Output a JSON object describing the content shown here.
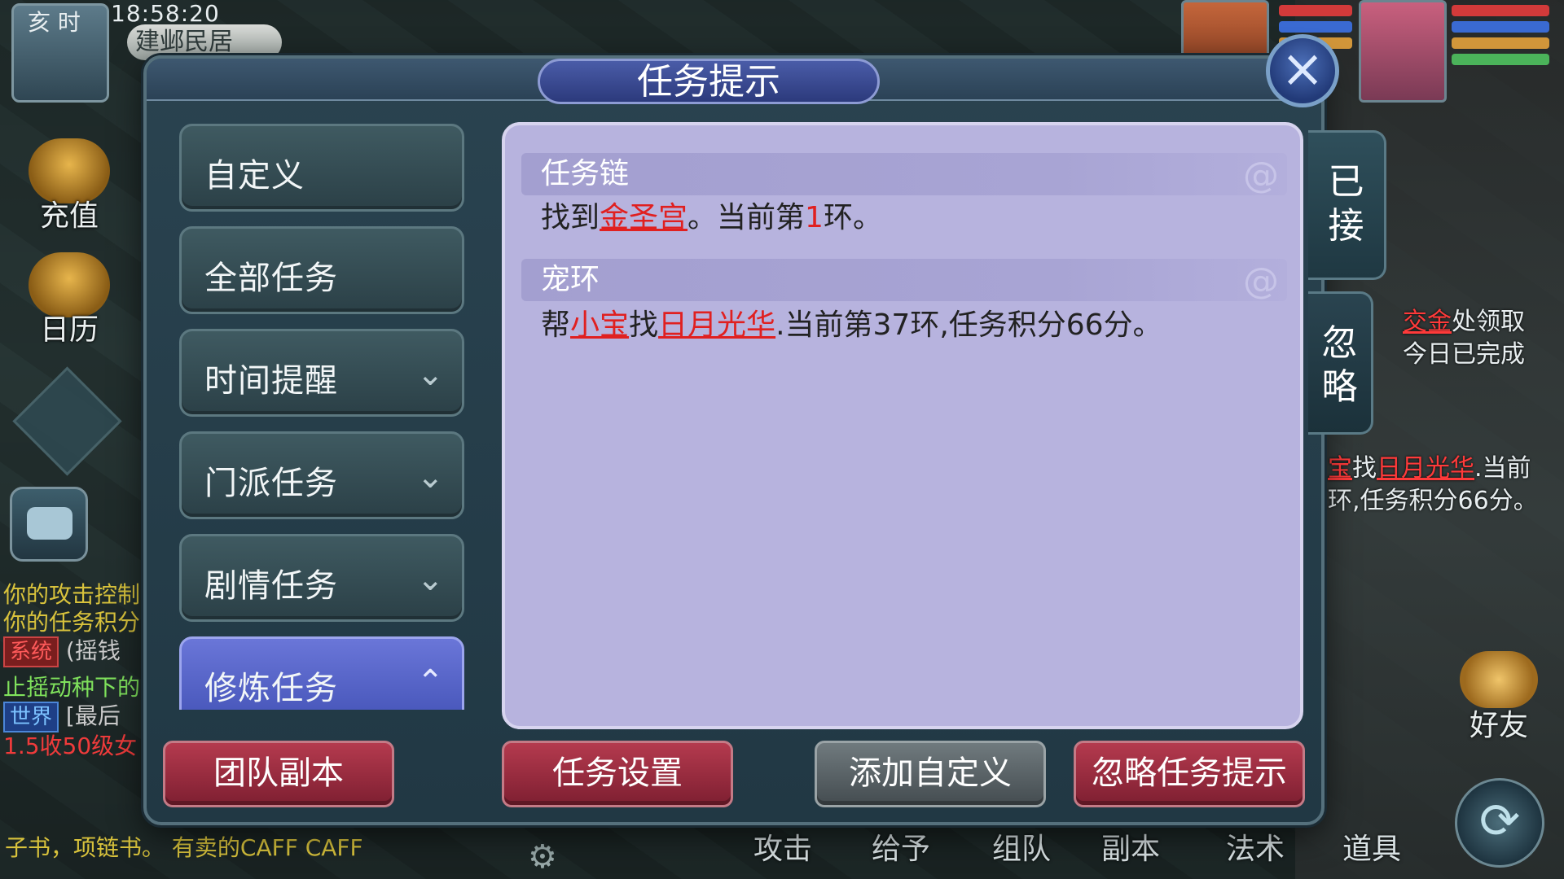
{
  "hud": {
    "clock_badge": "亥 时",
    "time": "18:58:20",
    "location": "建邺民居",
    "recharge_label": "充值",
    "calendar_label": "日历",
    "friend_label": "好友"
  },
  "chat": {
    "line1": "你的攻击控制",
    "line2": "你的任务积分",
    "system_tag": "系统",
    "line3": "(摇钱",
    "line4": "止摇动种下的",
    "world_tag": "世界",
    "line5": "[最后",
    "line6": "1.5收50级女",
    "ticker": "子书，项链书。  有卖的CAFF  CAFF"
  },
  "right_hud": {
    "text1_red": "交金",
    "text1_rest": "处领取",
    "text2": "今日已完成",
    "text3_red1": "宝",
    "text3_mid": "找",
    "text3_red2": "日月光华",
    "text3_rest": ".当前",
    "text4": "环,任务积分66分。"
  },
  "bottom_bar": [
    "攻击",
    "给予",
    "组队",
    "副本",
    "法术",
    "道具"
  ],
  "modal": {
    "title": "任务提示",
    "close_icon": "×",
    "categories": [
      {
        "label": "自定义",
        "chevron": ""
      },
      {
        "label": "全部任务",
        "chevron": ""
      },
      {
        "label": "时间提醒",
        "chevron": "⌄"
      },
      {
        "label": "门派任务",
        "chevron": "⌄"
      },
      {
        "label": "剧情任务",
        "chevron": "⌄"
      },
      {
        "label": "修炼任务",
        "chevron": "⌃"
      }
    ],
    "tasks": [
      {
        "title": "任务链",
        "p1": "找到",
        "link1": "金圣宫",
        "p2": "。当前第",
        "num": "1",
        "p3": "环。"
      },
      {
        "title": "宠环",
        "p1": "帮",
        "link1": "小宝",
        "p2": "找",
        "link2": "日月光华",
        "p3": ".当前第37环,任务积分66分。"
      }
    ],
    "side_tabs": {
      "accepted": "已\n接",
      "ignore": "忽\n略"
    },
    "buttons": {
      "team_dungeon": "团队副本",
      "task_settings": "任务设置",
      "add_custom": "添加自定义",
      "ignore_hint": "忽略任务提示"
    }
  },
  "colors": {
    "panel_bg": "#b7b3de",
    "accent_red": "#e02020",
    "button_red": "#b43a4e",
    "active_tab": "#5a66c8"
  }
}
